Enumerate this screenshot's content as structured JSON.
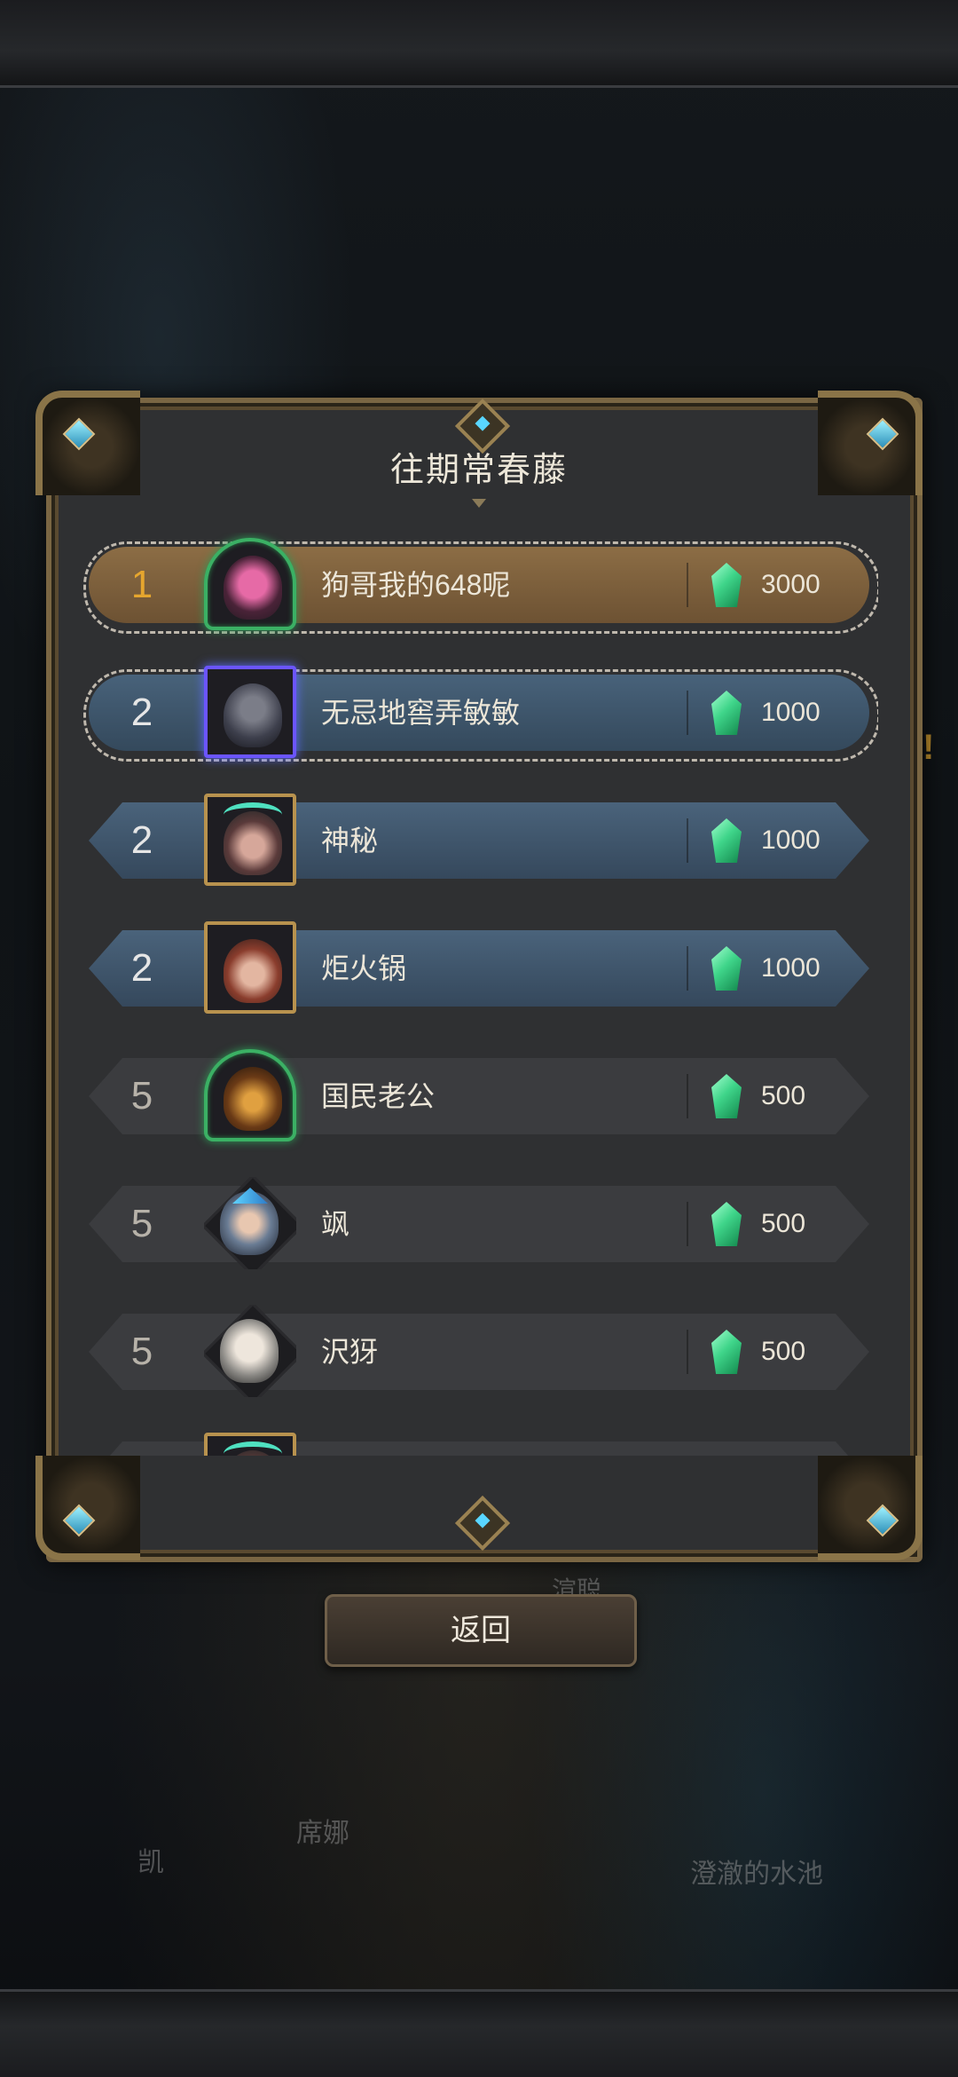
{
  "dialog": {
    "title": "往期常春藤",
    "back_label": "返回"
  },
  "currency_icon": "green-crystal-icon",
  "colors": {
    "gold_row": "#8c6d45",
    "blue_row": "#4a637b",
    "dark_row": "#3b3c3f",
    "rank_gold": "#e6a62e",
    "frame": "#7a6643"
  },
  "rankings": [
    {
      "rank": "1",
      "name": "狗哥我的648呢",
      "amount": "3000"
    },
    {
      "rank": "2",
      "name": "无忌地窖弄敏敏",
      "amount": "1000"
    },
    {
      "rank": "2",
      "name": "神秘",
      "amount": "1000"
    },
    {
      "rank": "2",
      "name": "炬火锅",
      "amount": "1000"
    },
    {
      "rank": "5",
      "name": "国民老公",
      "amount": "500"
    },
    {
      "rank": "5",
      "name": "飒",
      "amount": "500"
    },
    {
      "rank": "5",
      "name": "沢犽",
      "amount": "500"
    }
  ],
  "background": {
    "labels": [
      "凯",
      "席娜",
      "澄澈的水池",
      "渲聪"
    ]
  }
}
